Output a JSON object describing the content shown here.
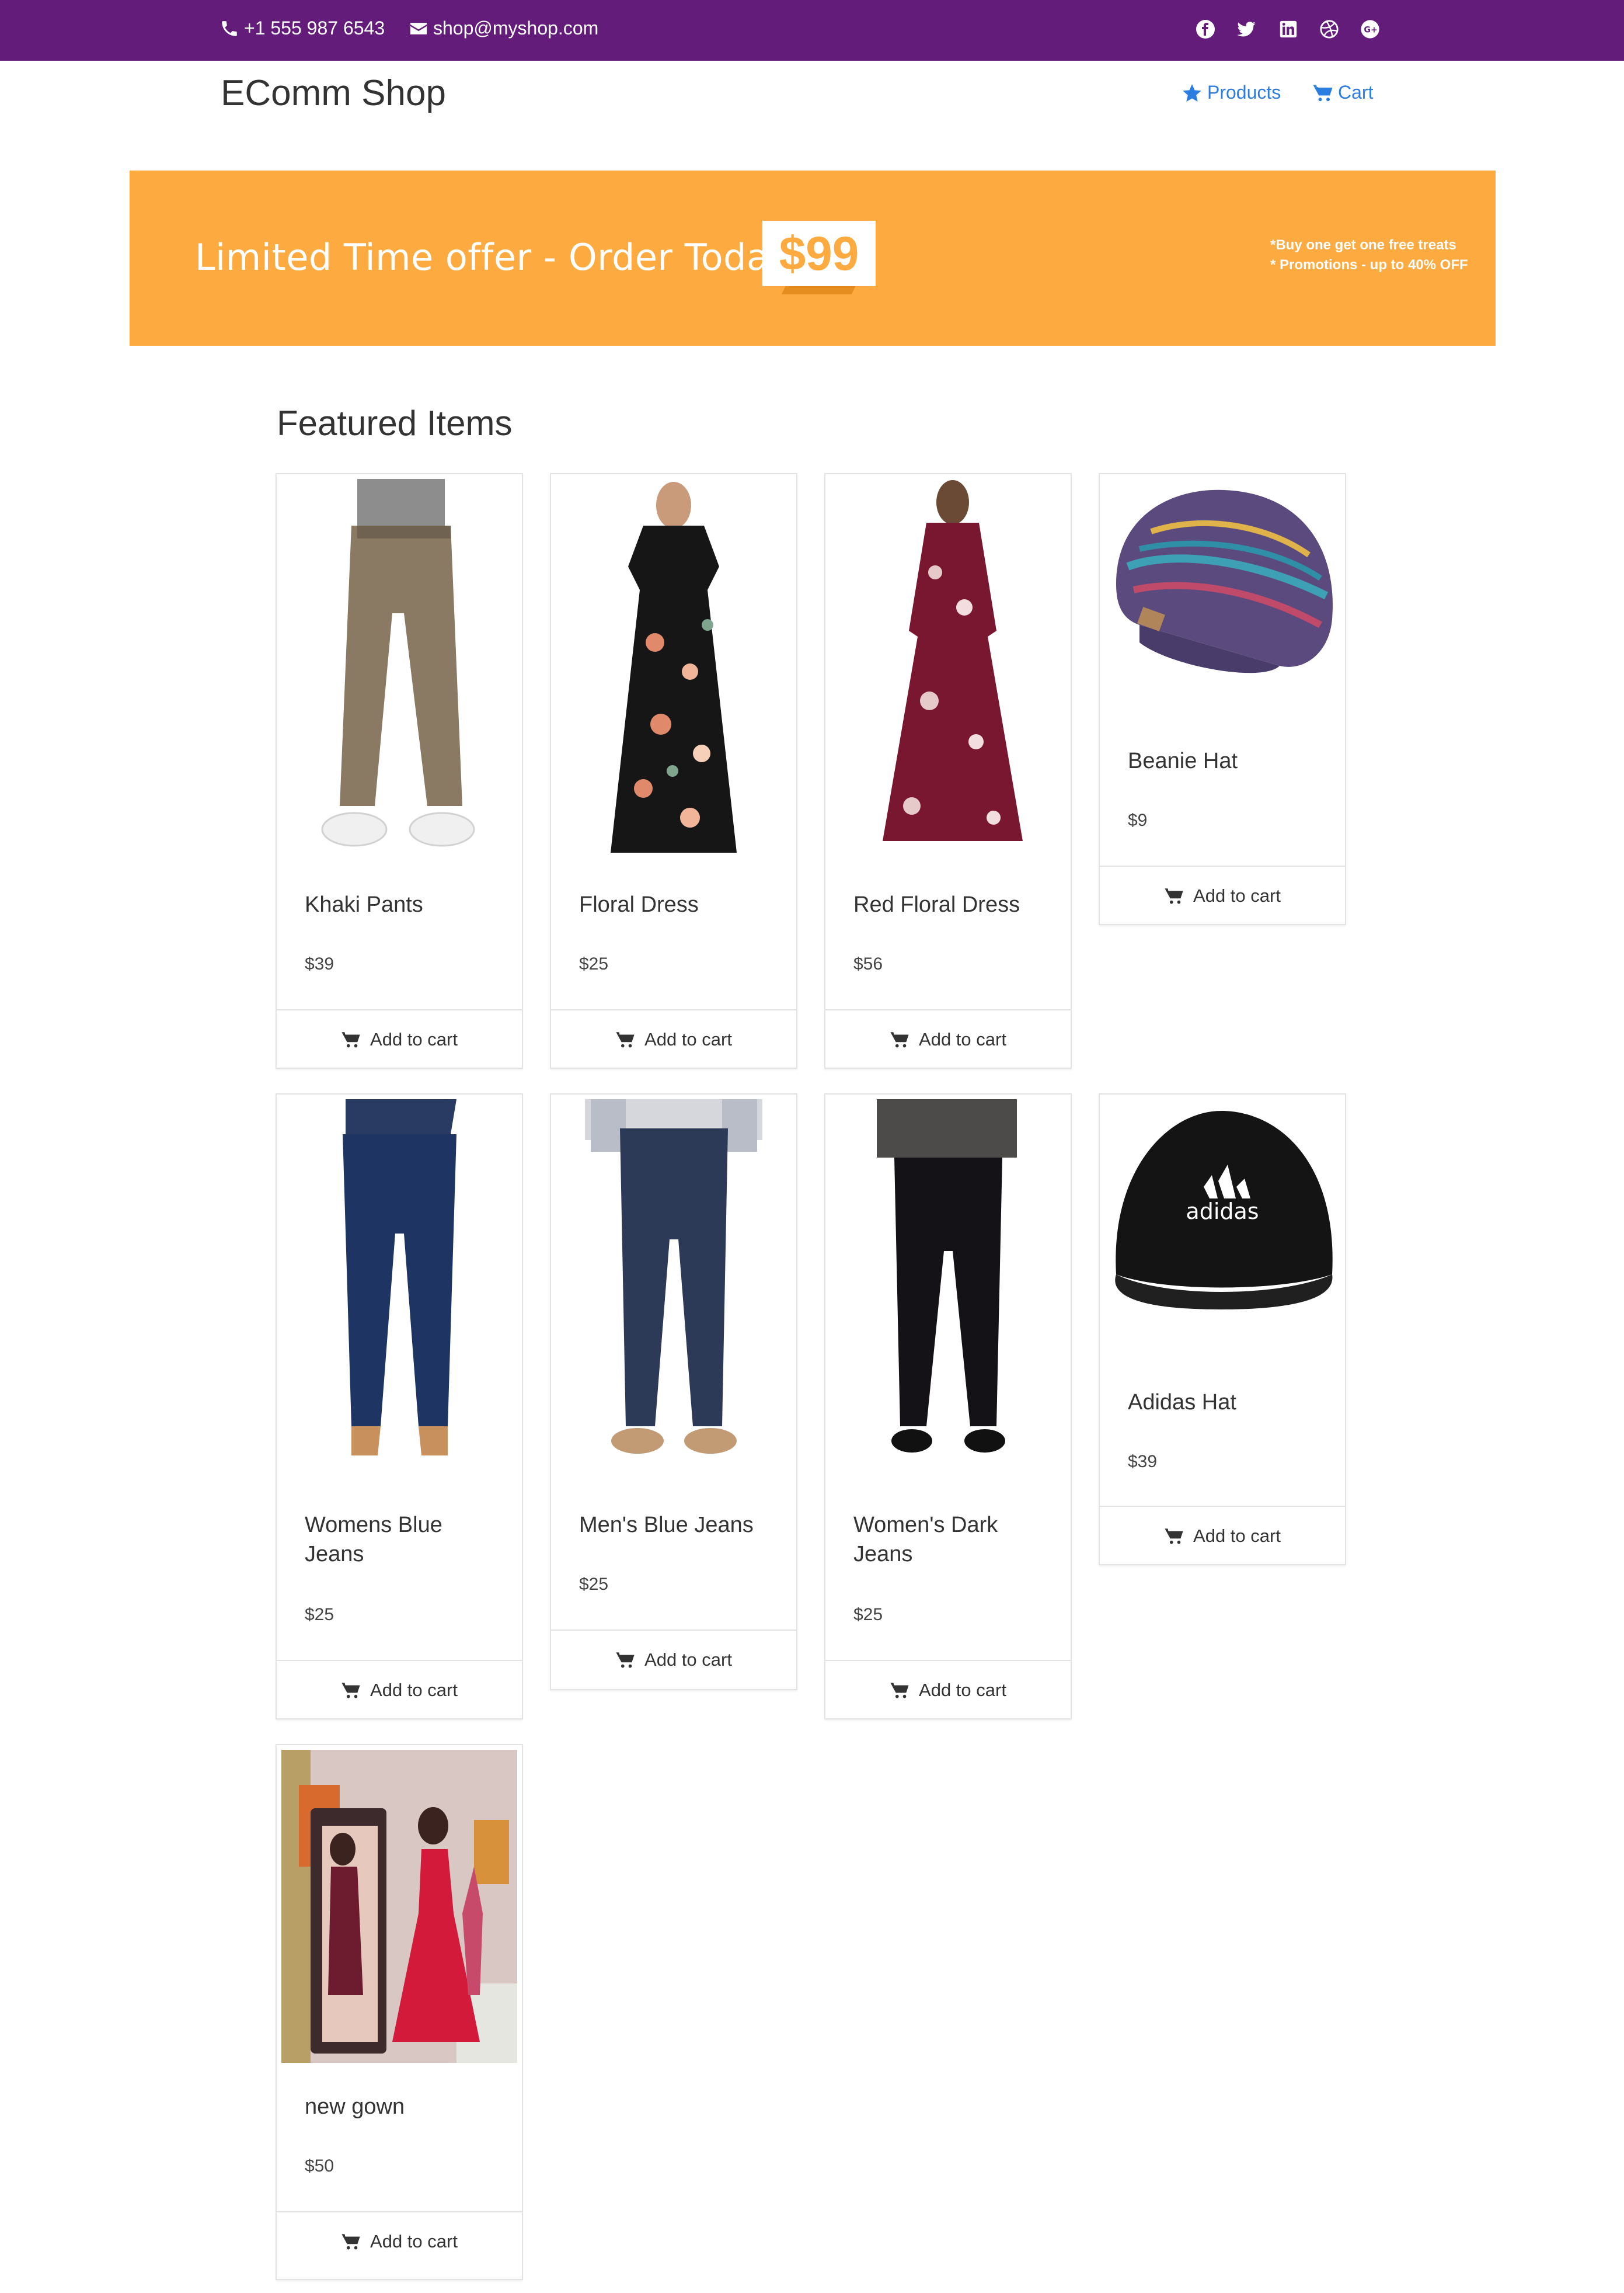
{
  "topbar": {
    "phone": "+1 555 987 6543",
    "email": "shop@myshop.com",
    "social_icons": [
      "facebook-icon",
      "twitter-icon",
      "linkedin-icon",
      "dribbble-icon",
      "google-plus-icon"
    ],
    "background": "#641c7b"
  },
  "nav": {
    "brand": "EComm Shop",
    "products_label": "Products",
    "cart_label": "Cart",
    "link_color": "#2b7de1"
  },
  "banner": {
    "text": "Limited Time offer - Order Today For",
    "price": "$99",
    "promo_line1": "*Buy one get one free treats",
    "promo_line2": "* Promotions - up to 40% OFF",
    "background": "#fdab41"
  },
  "featured": {
    "title": "Featured Items",
    "add_to_cart_label": "Add to cart",
    "items": [
      {
        "name": "Khaki Pants",
        "price": "$39"
      },
      {
        "name": "Floral Dress",
        "price": "$25"
      },
      {
        "name": "Red Floral Dress",
        "price": "$56"
      },
      {
        "name": "Beanie Hat",
        "price": "$9"
      },
      {
        "name": "Womens Blue Jeans",
        "price": "$25"
      },
      {
        "name": "Men's Blue Jeans",
        "price": "$25"
      },
      {
        "name": "Women's Dark Jeans",
        "price": "$25"
      },
      {
        "name": "Adidas Hat",
        "price": "$39",
        "logo_text": "adidas"
      },
      {
        "name": "new gown",
        "price": "$50"
      }
    ]
  }
}
